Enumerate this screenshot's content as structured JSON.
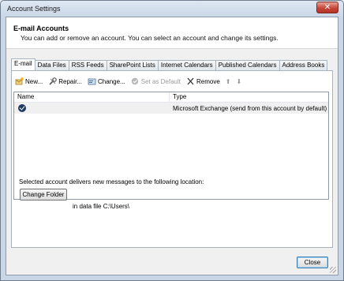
{
  "window": {
    "title": "Account Settings",
    "close_glyph": "✕"
  },
  "header": {
    "title": "E-mail Accounts",
    "description": "You can add or remove an account. You can select an account and change its settings."
  },
  "tabs": [
    {
      "label": "E-mail",
      "active": true
    },
    {
      "label": "Data Files"
    },
    {
      "label": "RSS Feeds"
    },
    {
      "label": "SharePoint Lists"
    },
    {
      "label": "Internet Calendars"
    },
    {
      "label": "Published Calendars"
    },
    {
      "label": "Address Books"
    }
  ],
  "toolbar": {
    "new_label": "New...",
    "repair_label": "Repair...",
    "change_label": "Change...",
    "default_label": "Set as Default",
    "remove_label": "Remove",
    "up_glyph": "⬆",
    "down_glyph": "⬇"
  },
  "list": {
    "columns": {
      "name": "Name",
      "type": "Type"
    },
    "rows": [
      {
        "name": "",
        "type": "Microsoft Exchange (send from this account by default)"
      }
    ]
  },
  "delivery": {
    "text": "Selected account delivers new messages to the following location:",
    "change_folder_label": "Change Folder",
    "data_file_text": "in data file C:\\Users\\"
  },
  "footer": {
    "close_label": "Close"
  },
  "colors": {
    "accent": "#3c7fb1",
    "title_close": "#c7483a",
    "check": "#1f3a5f"
  }
}
